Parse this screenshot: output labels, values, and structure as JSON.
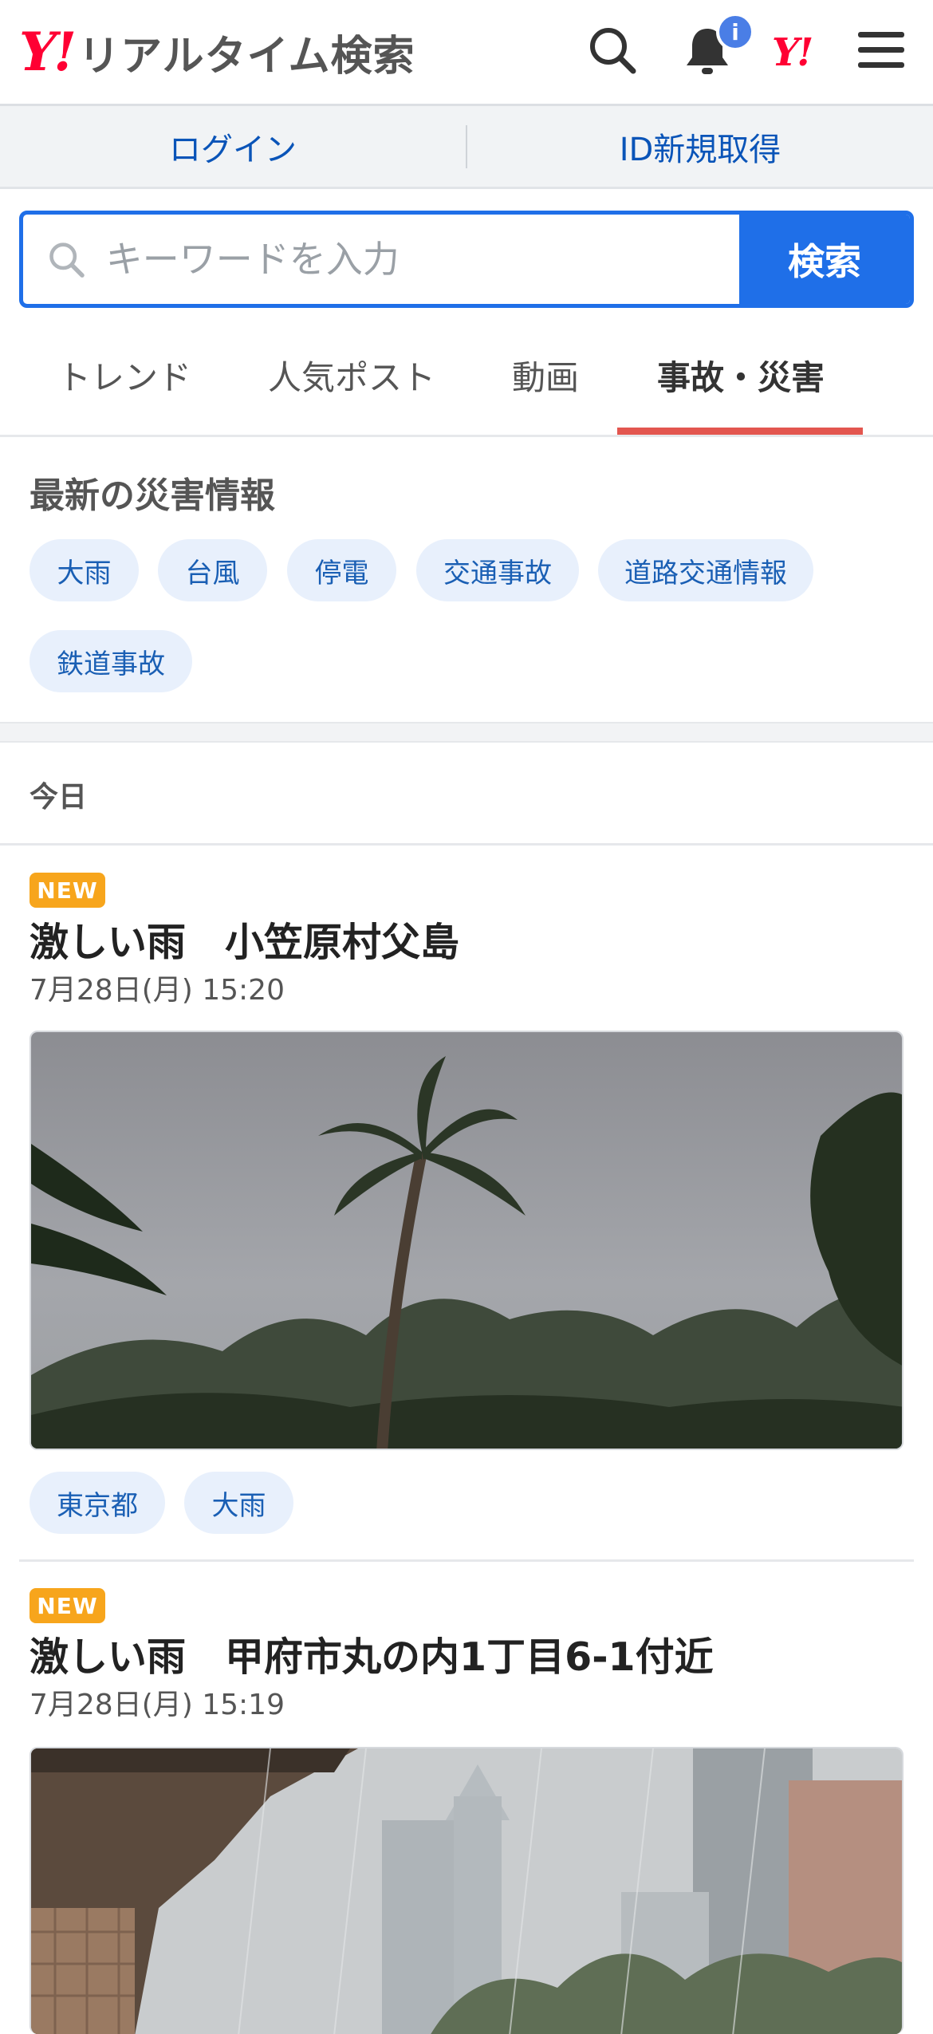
{
  "header": {
    "logo_mark": "Y!",
    "logo_text": "リアルタイム検索",
    "notification_badge": "i",
    "yahoo_mark": "Y!"
  },
  "account": {
    "login": "ログイン",
    "register": "ID新規取得"
  },
  "search": {
    "placeholder": "キーワードを入力",
    "button": "検索"
  },
  "tabs": [
    "トレンド",
    "人気ポスト",
    "動画",
    "事故・災害"
  ],
  "disaster_info": {
    "title": "最新の災害情報",
    "chips": [
      "大雨",
      "台風",
      "停電",
      "交通事故",
      "道路交通情報",
      "鉄道事故"
    ]
  },
  "date_group": "今日",
  "posts": [
    {
      "badge": "NEW",
      "title": "激しい雨　小笠原村父島",
      "date": "7月28日(月) 15:20",
      "image": "storm-palm-trees",
      "tags": [
        "東京都",
        "大雨"
      ]
    },
    {
      "badge": "NEW",
      "title": "激しい雨　甲府市丸の内1丁目6-1付近",
      "date": "7月28日(月) 15:19",
      "image": "rain-city-buildings"
    }
  ],
  "colors": {
    "brand_red": "#ff0033",
    "accent_blue": "#1f6fe8",
    "link_blue": "#0a54b8",
    "tab_underline": "#e3564f",
    "new_badge": "#f7a51c",
    "chip_bg": "#e8f0fc"
  }
}
